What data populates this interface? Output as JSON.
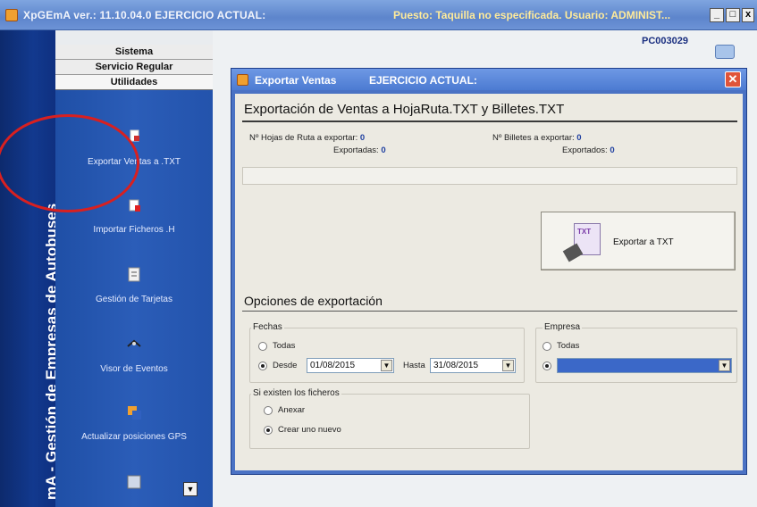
{
  "main_window": {
    "title": "XpGEmA ver.: 11.10.04.0  EJERCICIO ACTUAL:",
    "status": "Puesto: Taquilla no especificada. Usuario: ADMINIST...",
    "minimize": "_",
    "maximize": "□",
    "close": "x"
  },
  "banner": {
    "text": "mA - Gestión de Empresas de Autobuses"
  },
  "menu": {
    "headers": [
      "Sistema",
      "Servicio Regular",
      "Utilidades"
    ],
    "items": [
      {
        "label": "Exportar Ventas a .TXT",
        "icon": "export-icon"
      },
      {
        "label": "Importar Ficheros .H",
        "icon": "import-icon"
      },
      {
        "label": "Gestión de Tarjetas",
        "icon": "cards-icon"
      },
      {
        "label": "Visor de Eventos",
        "icon": "events-icon"
      },
      {
        "label": "Actualizar posiciones GPS",
        "icon": "gps-icon"
      }
    ]
  },
  "pc": {
    "name": "PC003029"
  },
  "dialog": {
    "title": "Exportar Ventas",
    "subtitle": "EJERCICIO ACTUAL:",
    "close": "✕",
    "heading": "Exportación de Ventas a HojaRuta.TXT y Billetes.TXT",
    "hojas_label": "Nº Hojas de Ruta a exportar:",
    "hojas_value": "0",
    "hojas_exportadas_label": "Exportadas:",
    "hojas_exportadas_value": "0",
    "billetes_label": "Nº Billetes a exportar:",
    "billetes_value": "0",
    "billetes_exportados_label": "Exportados:",
    "billetes_exportados_value": "0",
    "progress": 0,
    "export_button": "Exportar a TXT",
    "export_icon_text": "TXT",
    "options_heading": "Opciones de exportación",
    "fechas": {
      "label": "Fechas",
      "todas": "Todas",
      "desde": "Desde",
      "desde_value": "01/08/2015",
      "hasta": "Hasta",
      "hasta_value": "31/08/2015",
      "selected": "desde"
    },
    "empresa": {
      "label": "Empresa",
      "todas": "Todas",
      "selected": "specific",
      "value": ""
    },
    "ficheros": {
      "label": "Si existen los ficheros",
      "anexar": "Anexar",
      "crear": "Crear uno nuevo",
      "selected": "crear"
    }
  }
}
